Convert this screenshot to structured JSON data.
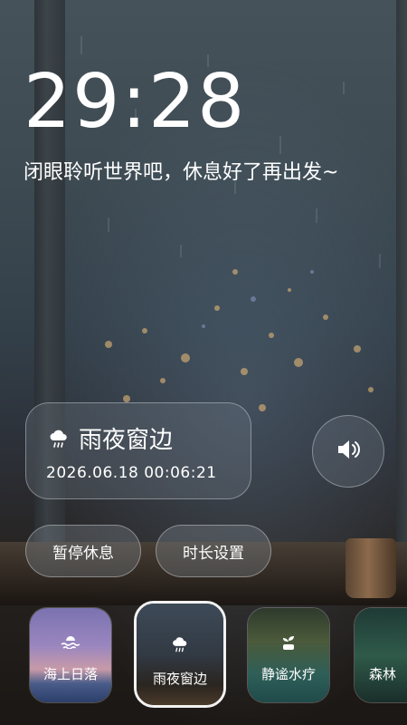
{
  "clock": {
    "time": "29:28"
  },
  "message": "闭眼聆听世界吧，休息好了再出发~",
  "now_playing": {
    "title": "雨夜窗边",
    "datetime": "2026.06.18  00:06:21",
    "icon": "rain-cloud-icon"
  },
  "controls": {
    "sound_icon": "speaker-icon",
    "pause_label": "暂停休息",
    "duration_label": "时长设置"
  },
  "scenes": [
    {
      "label": "海上日落",
      "icon": "sea-wave-icon"
    },
    {
      "label": "雨夜窗边",
      "icon": "rain-cloud-icon",
      "selected": true
    },
    {
      "label": "静谧水疗",
      "icon": "sprout-icon"
    },
    {
      "label": "森林",
      "icon": ""
    }
  ],
  "colors": {
    "text": "#ffffff",
    "selected_border": "#f2f2f2"
  }
}
